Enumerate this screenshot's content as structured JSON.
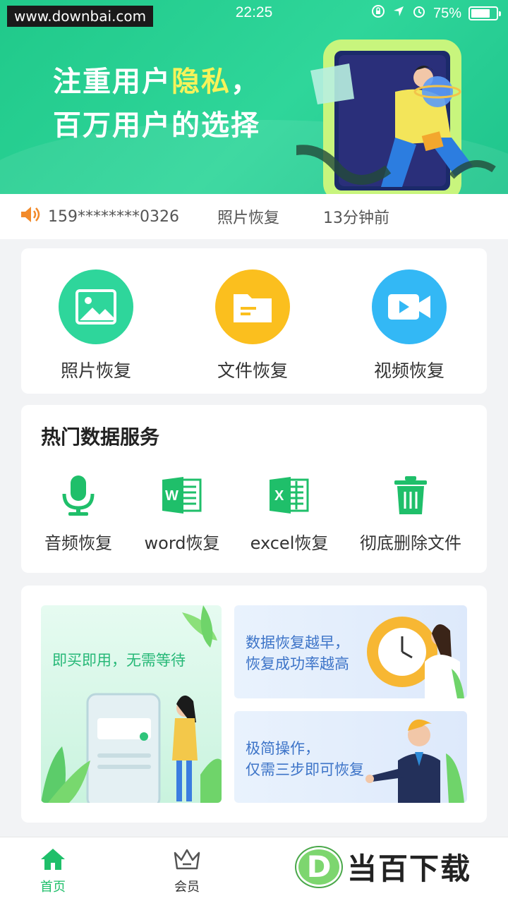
{
  "status_bar": {
    "watermark": "www.downbai.com",
    "time": "22:25",
    "battery": "75%",
    "battery_level": 0.75
  },
  "banner": {
    "slogan_line1_prefix": "注重用户",
    "slogan_line1_highlight": "隐私",
    "slogan_line1_suffix": "，",
    "slogan_line2": "百万用户的选择"
  },
  "ticker": {
    "phone": "159********0326",
    "service": "照片恢复",
    "time_ago": "13分钟前"
  },
  "main_services": [
    {
      "label": "照片恢复",
      "icon": "image-icon",
      "color": "#2ed69b"
    },
    {
      "label": "文件恢复",
      "icon": "folder-icon",
      "color": "#fbbf1e"
    },
    {
      "label": "视频恢复",
      "icon": "video-camera-icon",
      "color": "#33b8f5"
    }
  ],
  "hot_services": {
    "title": "热门数据服务",
    "items": [
      {
        "label": "音频恢复",
        "icon": "microphone-icon"
      },
      {
        "label": "word恢复",
        "icon": "word-icon"
      },
      {
        "label": "excel恢复",
        "icon": "excel-icon"
      },
      {
        "label": "彻底删除文件",
        "icon": "trash-icon"
      }
    ],
    "icon_color": "#1fbf6a"
  },
  "promos": {
    "left": "即买即用，无需等待",
    "top_right": [
      "数据恢复越早，",
      "恢复成功率越高"
    ],
    "bottom_right": [
      "极简操作，",
      "仅需三步即可恢复"
    ]
  },
  "tabbar": {
    "home": "首页",
    "member": "会员",
    "active_color": "#1fbf6a"
  },
  "brand": {
    "logo_letter": "D",
    "name": "当百下载"
  }
}
